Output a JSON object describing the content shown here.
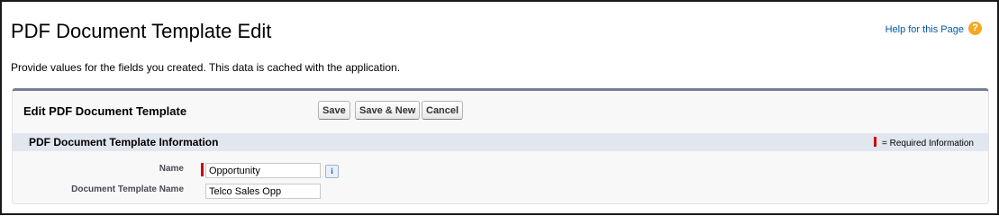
{
  "header": {
    "title": "PDF Document Template Edit",
    "help_link": "Help for this Page",
    "help_icon": "help-icon",
    "description": "Provide values for the fields you created. This data is cached with the application."
  },
  "edit_panel": {
    "title": "Edit PDF Document Template",
    "buttons": {
      "save": "Save",
      "save_new": "Save & New",
      "cancel": "Cancel"
    }
  },
  "section": {
    "title": "PDF Document Template Information",
    "required_legend": "= Required Information"
  },
  "fields": {
    "name": {
      "label": "Name",
      "value": "Opportunity",
      "required": true,
      "info_icon": "i"
    },
    "document_template_name": {
      "label": "Document Template Name",
      "value": "Telco Sales Opp",
      "required": false
    }
  },
  "colors": {
    "required": "#cc0000",
    "panel_border": "#747e96",
    "section_bar": "#e2e6ef",
    "link": "#015ba7",
    "help_icon": "#f3a923"
  }
}
